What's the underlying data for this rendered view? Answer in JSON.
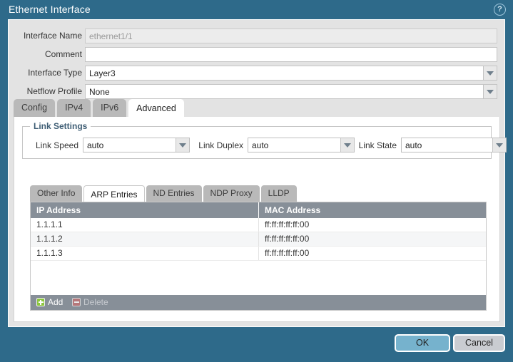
{
  "window": {
    "title": "Ethernet Interface",
    "help_icon": "help-circle-icon",
    "help_glyph": "?"
  },
  "form": {
    "rows": [
      {
        "label": "Interface Name",
        "value": "ethernet1/1",
        "readonly": true,
        "dropdown": false
      },
      {
        "label": "Comment",
        "value": "",
        "readonly": false,
        "dropdown": false
      },
      {
        "label": "Interface Type",
        "value": "Layer3",
        "readonly": false,
        "dropdown": true
      },
      {
        "label": "Netflow Profile",
        "value": "None",
        "readonly": false,
        "dropdown": true
      }
    ]
  },
  "tabs": {
    "items": [
      {
        "label": "Config",
        "active": false
      },
      {
        "label": "IPv4",
        "active": false
      },
      {
        "label": "IPv6",
        "active": false
      },
      {
        "label": "Advanced",
        "active": true
      }
    ]
  },
  "link_settings": {
    "legend": "Link Settings",
    "fields": [
      {
        "label": "Link Speed",
        "value": "auto"
      },
      {
        "label": "Link Duplex",
        "value": "auto"
      },
      {
        "label": "Link State",
        "value": "auto"
      }
    ]
  },
  "inner_tabs": {
    "items": [
      {
        "label": "Other Info",
        "active": false
      },
      {
        "label": "ARP Entries",
        "active": true
      },
      {
        "label": "ND Entries",
        "active": false
      },
      {
        "label": "NDP Proxy",
        "active": false
      },
      {
        "label": "LLDP",
        "active": false
      }
    ]
  },
  "grid": {
    "columns": [
      "IP Address",
      "MAC Address"
    ],
    "rows": [
      {
        "ip": "1.1.1.1",
        "mac": "ff:ff:ff:ff:ff:00"
      },
      {
        "ip": "1.1.1.2",
        "mac": "ff:ff:ff:ff:ff:00"
      },
      {
        "ip": "1.1.1.3",
        "mac": "ff:ff:ff:ff:ff:00"
      }
    ],
    "toolbar": {
      "add_label": "Add",
      "delete_label": "Delete",
      "add_icon": "plus-icon",
      "delete_icon": "minus-icon",
      "delete_disabled": true
    }
  },
  "footer": {
    "ok_label": "OK",
    "cancel_label": "Cancel"
  },
  "colors": {
    "title_bar": "#2e6a8a",
    "panel_bg": "#e3e3e3",
    "tab_inactive": "#b9b9b9",
    "grid_header": "#878f98",
    "ok_button": "#76b2cd",
    "cancel_button": "#c9ccd1",
    "legend_text": "#3f5e75",
    "add_icon_green": "#8cc63e"
  }
}
